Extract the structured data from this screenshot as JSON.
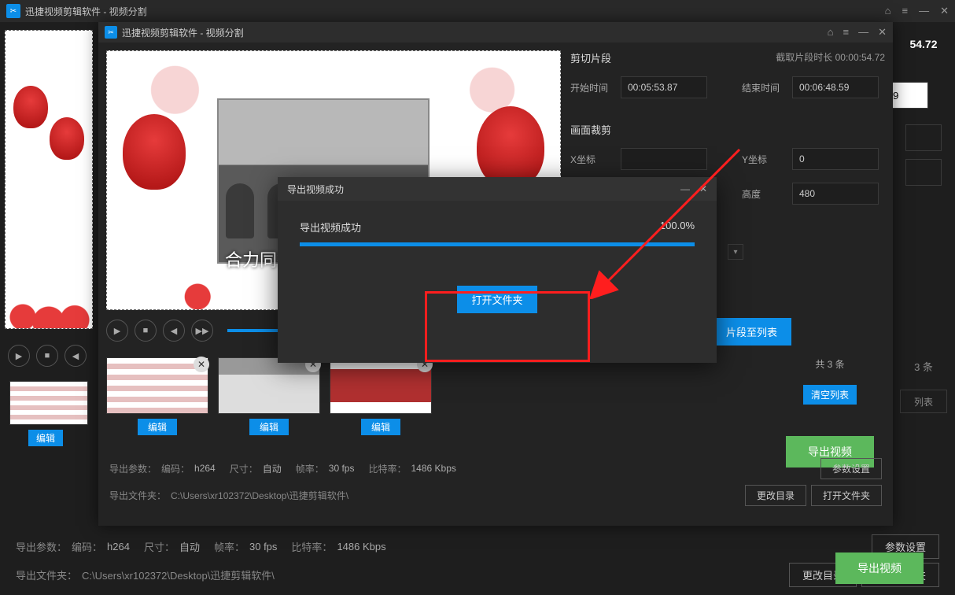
{
  "outer": {
    "title": "迅捷视频剪辑软件 - 视频分割",
    "duration_short": "54.72",
    "count_text": "3 条",
    "list_button": "列表",
    "edit_label": "编辑",
    "export_label": "导出视频",
    "params": {
      "label": "导出参数：",
      "codec_label": "编码：",
      "codec_value": "h264",
      "size_label": "尺寸：",
      "size_value": "自动",
      "fps_label": "帧率：",
      "fps_value": "30 fps",
      "bitrate_label": "比特率：",
      "bitrate_value": "1486 Kbps",
      "settings_btn": "参数设置",
      "folder_label": "导出文件夹：",
      "folder_value": "C:\\Users\\xr102372\\Desktop\\迅捷剪辑软件\\",
      "change_dir_btn": "更改目录",
      "open_folder_btn": "打开文件夹"
    },
    "field_placeholder": "9"
  },
  "inner": {
    "title": "迅捷视频剪辑软件 - 视频分割",
    "caption": "合力同行",
    "clip_section": "剪切片段",
    "duration_label": "截取片段时长",
    "duration_value": "00:00:54.72",
    "start_label": "开始时间",
    "start_value": "00:05:53.87",
    "end_label": "结束时间",
    "end_value": "00:06:48.59",
    "crop_section": "画面裁剪",
    "x_label": "X坐标",
    "y_label": "Y坐标",
    "y_value": "0",
    "height_label": "高度",
    "height_value": "480",
    "add_clip_btn": "片段至列表",
    "count_text": "共 3 条",
    "clear_btn": "清空列表",
    "export_btn": "导出视频",
    "params": {
      "label": "导出参数：",
      "codec_label": "编码：",
      "codec_value": "h264",
      "size_label": "尺寸：",
      "size_value": "自动",
      "fps_label": "帧率：",
      "fps_value": "30 fps",
      "bitrate_label": "比特率：",
      "bitrate_value": "1486 Kbps",
      "settings_btn": "参数设置",
      "folder_label": "导出文件夹：",
      "folder_value": "C:\\Users\\xr102372\\Desktop\\迅捷剪辑软件\\",
      "change_dir_btn": "更改目录",
      "open_folder_btn": "打开文件夹"
    },
    "thumb_edit": "编辑"
  },
  "modal": {
    "title": "导出视频成功",
    "message": "导出视频成功",
    "percent": "100.0%",
    "open_btn": "打开文件夹"
  },
  "icons": {
    "home": "⌂",
    "menu": "≡",
    "minimize": "—",
    "close": "✕",
    "play": "▶",
    "stop": "■",
    "prev": "◀",
    "next": "▶|",
    "step": "▶▶",
    "minimize_dash": "—",
    "dropdown": "▾",
    "scissors": "✂"
  }
}
